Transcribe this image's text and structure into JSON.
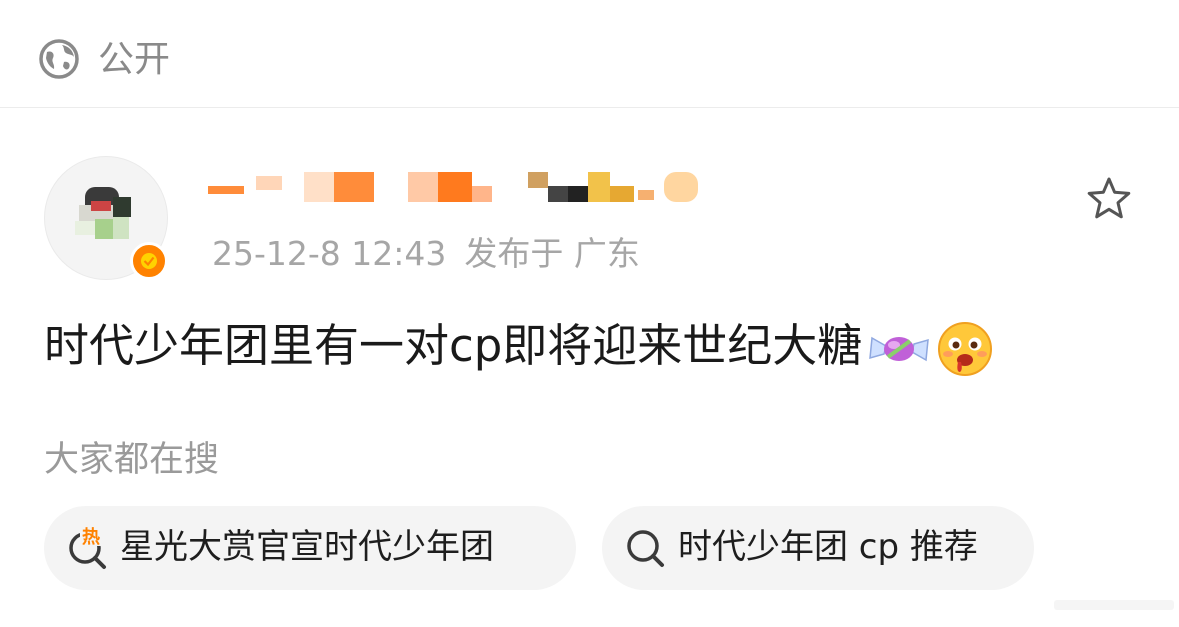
{
  "header": {
    "visibility_label": "公开",
    "visibility_icon": "globe-icon"
  },
  "post": {
    "timestamp": "25-12-8 12:43",
    "location": "发布于 广东",
    "text": "时代少年团里有一对cp即将迎来世纪大糖",
    "emojis": [
      "candy-emoji",
      "drooling-face-emoji"
    ],
    "verified": true,
    "favorite_icon": "star-icon"
  },
  "search_suggestions": {
    "title": "大家都在搜",
    "items": [
      {
        "label": "星光大赏官宣时代少年团",
        "icon": "hot-search-icon"
      },
      {
        "label": "时代少年团 cp 推荐",
        "icon": "search-icon"
      }
    ]
  },
  "colors": {
    "accent": "#ff8200",
    "text_primary": "#1a1a1a",
    "text_secondary": "#a6a6a6",
    "chip_bg": "#f4f4f4"
  }
}
